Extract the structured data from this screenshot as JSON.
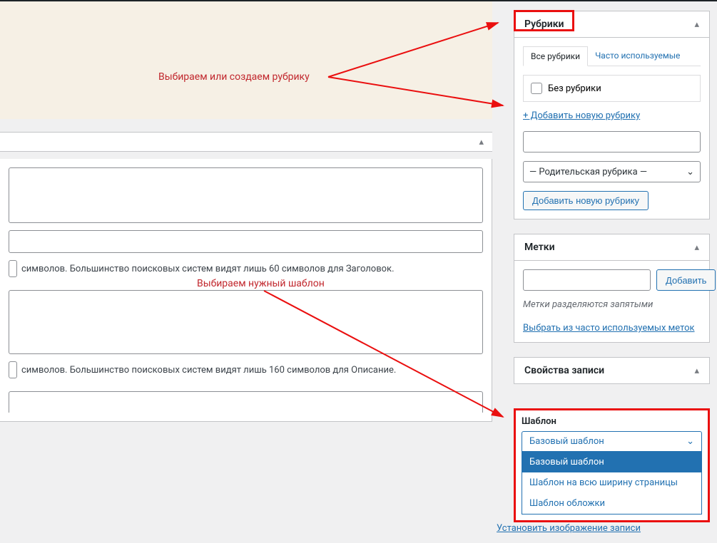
{
  "annotations": {
    "pick_create_rubric": "Выбираем или создаем рубрику",
    "pick_template": "Выбираем нужный шаблон"
  },
  "rubrics": {
    "title": "Рубрики",
    "tab_all": "Все рубрики",
    "tab_freq": "Часто используемые",
    "no_rubric": "Без рубрики",
    "add_new_link": "+ Добавить новую рубрику",
    "parent_placeholder": "— Родительская рубрика —",
    "add_btn": "Добавить новую рубрику"
  },
  "tags": {
    "title": "Метки",
    "add_btn": "Добавить",
    "hint": "Метки разделяются запятыми",
    "freq_link": "Выбрать из часто используемых меток"
  },
  "post_props": {
    "title": "Свойства записи"
  },
  "template": {
    "label": "Шаблон",
    "selected": "Базовый шаблон",
    "options": [
      "Базовый шаблон",
      "Шаблон на всю ширину страницы",
      "Шаблон обложки"
    ]
  },
  "featured_image": "Установить изображение записи",
  "hints": {
    "title_hint": "символов. Большинство поисковых систем видят лишь 60 символов для Заголовок.",
    "desc_hint": "символов. Большинство поисковых систем видят лишь 160 символов для Описание."
  }
}
